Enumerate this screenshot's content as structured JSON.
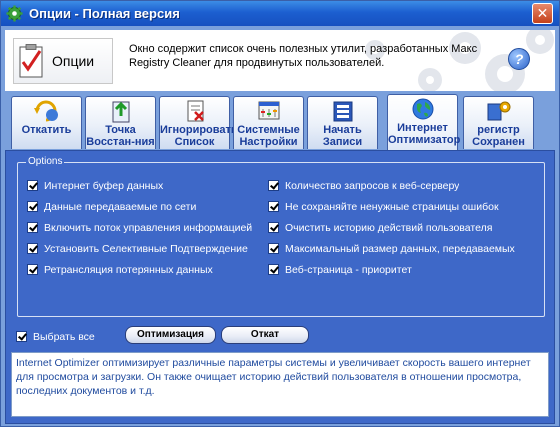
{
  "window": {
    "title": "Опции - Полная версия",
    "close_glyph": "✕"
  },
  "header": {
    "logo_label": "Опции",
    "description": "Окно содержит список очень полезных утилит, разработанных Макс Registry Cleaner для продвинутых пользователей.",
    "help_glyph": "?"
  },
  "tabs": [
    {
      "label": "Откатить",
      "icon": "restore-icon",
      "active": false
    },
    {
      "label": "Точка Восстан-ния",
      "icon": "restore-point-icon",
      "active": false
    },
    {
      "label": "Игнорировать Список",
      "icon": "ignore-list-icon",
      "active": false
    },
    {
      "label": "Системные Настройки",
      "icon": "system-settings-icon",
      "active": false
    },
    {
      "label": "Начать Записи",
      "icon": "startup-entries-icon",
      "active": false
    },
    {
      "label": "Интернет Оптимизатор",
      "icon": "internet-globe-icon",
      "active": true
    },
    {
      "label": "регистр Сохранен",
      "icon": "registry-backup-icon",
      "active": false
    }
  ],
  "options": {
    "legend": "Options",
    "left": [
      {
        "label": "Интернет  буфер данных",
        "checked": true
      },
      {
        "label": "Данные передаваемые по сети",
        "checked": true
      },
      {
        "label": "Включить поток управления информацией",
        "checked": true
      },
      {
        "label": "Установить Селективные Подтверждение",
        "checked": true
      },
      {
        "label": "Ретрансляция потерянных данных",
        "checked": true
      }
    ],
    "right": [
      {
        "label": "Количество запросов к веб-серверу",
        "checked": true
      },
      {
        "label": "Не сохраняйте ненужные страницы ошибок",
        "checked": true
      },
      {
        "label": "Очистить историю действий пользователя",
        "checked": true
      },
      {
        "label": "Максимальный размер данных, передаваемых по сети",
        "checked": true
      },
      {
        "label": "Веб-страница - приоритет",
        "checked": true
      }
    ]
  },
  "controls": {
    "select_all_label": "Выбрать все",
    "select_all_checked": true,
    "optimize_button": "Оптимизация",
    "rollback_button": "Откат"
  },
  "info": {
    "text": "Internet Optimizer оптимизирует различные параметры системы и увеличивает скорость вашего интернет для просмотра и загрузки. Он также очищает историю действий пользователя в отношении просмотра, последних документов и т.д."
  }
}
